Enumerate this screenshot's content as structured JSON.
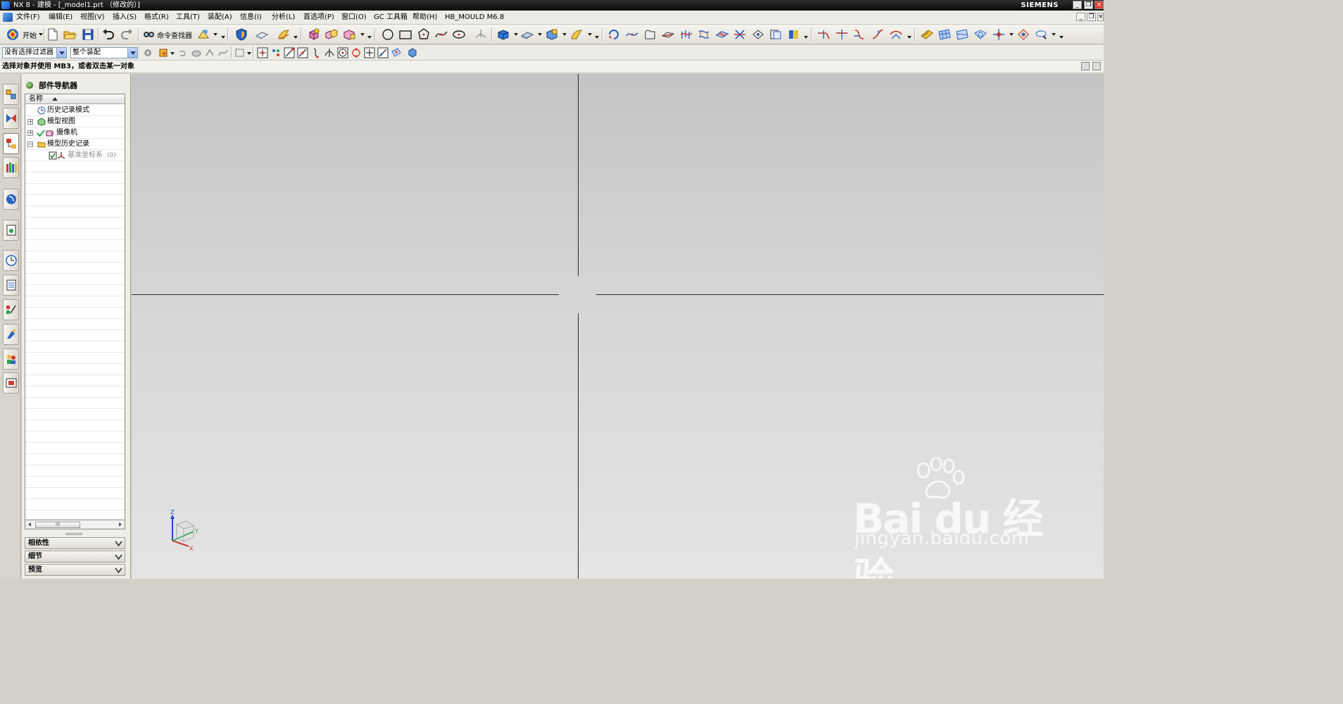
{
  "window": {
    "title": "NX 8 - 建模 - [_model1.prt （修改的）]",
    "brand": "SIEMENS"
  },
  "menu": [
    "文件(F)",
    "编辑(E)",
    "视图(V)",
    "插入(S)",
    "格式(R)",
    "工具(T)",
    "装配(A)",
    "信息(I)",
    "分析(L)",
    "首选项(P)",
    "窗口(O)",
    "GC 工具箱",
    "帮助(H)",
    "HB_MOULD M6.8"
  ],
  "toolbar": {
    "start_label": "开始",
    "command_finder_label": "命令查找器"
  },
  "selection_bar": {
    "type_filter": "没有选择过滤器",
    "scope": "整个装配"
  },
  "cue_line": "选择对象并使用 MB3，或者双击某一对象",
  "navigator": {
    "title": "部件导航器",
    "column_name": "名称",
    "nodes": [
      {
        "label": "历史记录模式"
      },
      {
        "label": "模型视图"
      },
      {
        "label": "摄像机"
      },
      {
        "label": "模型历史记录"
      },
      {
        "label": "基准坐标系",
        "suffix": "(0)"
      }
    ],
    "scroll_thumb": "III",
    "panels": [
      "相依性",
      "细节",
      "预览"
    ]
  },
  "triad": {
    "z": "Z",
    "y": "Y",
    "x": "X"
  },
  "watermark": {
    "line1": "Bai du 经验",
    "line2": "jingyan.baidu.com"
  },
  "colors": {
    "title_bar": "#111111",
    "graphics_top": "#c4c4c4",
    "graphics_bottom": "#e4e4e4",
    "view_lines": "#2d2d2d"
  }
}
